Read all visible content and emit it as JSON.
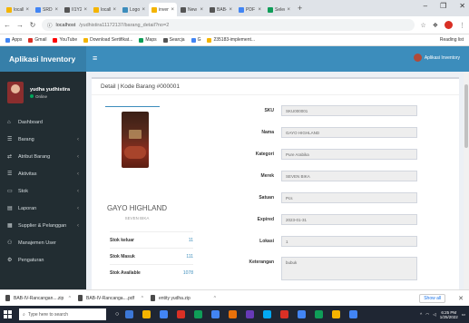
{
  "browser": {
    "tabs": [
      {
        "label": "localhost",
        "color": "#f4b400"
      },
      {
        "label": "SRD 07",
        "color": "#4285f4"
      },
      {
        "label": "II1Y2-u",
        "color": "#555555"
      },
      {
        "label": "localhost",
        "color": "#f4b400"
      },
      {
        "label": "Logout",
        "color": "#3c8dbc"
      },
      {
        "label": "inventor",
        "color": "#f4b400",
        "active": true
      },
      {
        "label": "New Tab",
        "color": "#555555"
      },
      {
        "label": "BAB-IV",
        "color": "#555555"
      },
      {
        "label": "PDF",
        "color": "#4285f4"
      },
      {
        "label": "Select",
        "color": "#0f9d58"
      }
    ],
    "new_tab_label": "+",
    "window_controls": {
      "minimize": "–",
      "restore": "❐",
      "close": "✕"
    },
    "url_host": "localhost",
    "url_path": "/yudhistira11172137/barang_detail?no=2",
    "bookmarks": [
      {
        "label": "Apps",
        "color": "#4285f4"
      },
      {
        "label": "Gmail",
        "color": "#d93025"
      },
      {
        "label": "YouTube",
        "color": "#ff0000"
      },
      {
        "label": "Download Sertifikat...",
        "color": "#f4b400"
      },
      {
        "label": "Maps",
        "color": "#0f9d58"
      },
      {
        "label": "Searcja",
        "color": "#555555"
      },
      {
        "label": "G",
        "color": "#4285f4"
      },
      {
        "label": "235183-implement...",
        "color": "#f4b400"
      }
    ],
    "reading_list": "Reading list"
  },
  "header": {
    "app_title": "Aplikasi Inventory",
    "menu_toggle": "≡",
    "user_label": "Aplikasi Inventory"
  },
  "sidebar": {
    "user_name": "yudha yudhistira",
    "user_status": "Online",
    "items": [
      {
        "icon": "⌂",
        "label": "Dashboard",
        "chevron": false
      },
      {
        "icon": "☰",
        "label": "Barang",
        "chevron": true
      },
      {
        "icon": "⇄",
        "label": "Atribut Barang",
        "chevron": true
      },
      {
        "icon": "☰",
        "label": "Aktivitas",
        "chevron": true
      },
      {
        "icon": "▭",
        "label": "Stok",
        "chevron": true
      },
      {
        "icon": "▤",
        "label": "Laporan",
        "chevron": true
      },
      {
        "icon": "▦",
        "label": "Supplier & Pelanggan",
        "chevron": true
      },
      {
        "icon": "⚇",
        "label": "Manajemen User",
        "chevron": false
      },
      {
        "icon": "⚙",
        "label": "Pengaturan",
        "chevron": false
      }
    ]
  },
  "detail": {
    "title": "Detail | Kode Barang #000001",
    "product_name": "GAYO HIGHLAND",
    "product_brand": "SEVEN BIKA",
    "stock": [
      {
        "label": "Stok keluar",
        "value": "11"
      },
      {
        "label": "Stok Masuk",
        "value": "111"
      },
      {
        "label": "Stok Available",
        "value": "1078"
      }
    ],
    "fields": [
      {
        "label": "SKU",
        "value": "SKU000001"
      },
      {
        "label": "Nama",
        "value": "GAYO HIGHLAND"
      },
      {
        "label": "Kategori",
        "value": "Pure Arabika"
      },
      {
        "label": "Merek",
        "value": "SEVEN BIKA"
      },
      {
        "label": "Satuan",
        "value": "Pcs"
      },
      {
        "label": "Expired",
        "value": "2023-01-31"
      },
      {
        "label": "Lokasi",
        "value": "1"
      },
      {
        "label": "Keterangan",
        "value": "bubuk"
      },
      {
        "label": "Barcode",
        "value": "5128924517401"
      }
    ]
  },
  "downloads": {
    "items": [
      {
        "label": "BAB-IV-Rancangan....zip"
      },
      {
        "label": "BAB-IV-Rancanga....pdf"
      },
      {
        "label": "entity yudha.zip"
      }
    ],
    "show_all": "Show all",
    "close": "✕"
  },
  "taskbar": {
    "search_placeholder": "Type here to search",
    "apps": [
      "#3c78d8",
      "#f4b400",
      "#4285f4",
      "#d93025",
      "#0f9d58",
      "#4285f4",
      "#e8710a",
      "#673ab7",
      "#03a9f4",
      "#d93025",
      "#4285f4",
      "#0f9d58",
      "#f4b400",
      "#4285f4"
    ],
    "time": "6:25 PM",
    "date": "1/25/2022"
  }
}
